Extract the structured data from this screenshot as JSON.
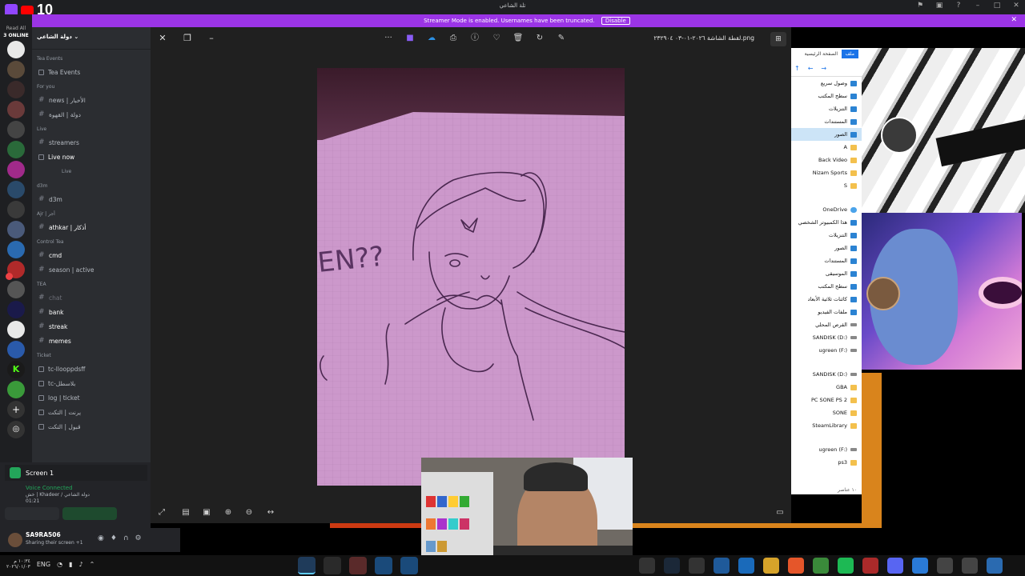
{
  "top": {
    "title": "تلة الشاعي",
    "number": "10",
    "streamer_message": "Streamer Mode is enabled. Usernames have been truncated.",
    "disable_label": "Disable"
  },
  "rail": {
    "read_all": "Read All",
    "online": "3 ONLINE"
  },
  "server": {
    "name": "دولة الشاعي"
  },
  "channels": [
    {
      "type": "cat",
      "label": "Tea Events"
    },
    {
      "type": "lock",
      "label": "Tea Events"
    },
    {
      "type": "cat",
      "label": "For you"
    },
    {
      "type": "hash",
      "label": "news | الأخبار"
    },
    {
      "type": "hash",
      "label": "دولة | القهوة"
    },
    {
      "type": "cat",
      "label": "Live"
    },
    {
      "type": "hash",
      "label": "streamers"
    },
    {
      "type": "lock-live",
      "label": "Live now"
    },
    {
      "type": "sub",
      "label": "Live"
    },
    {
      "type": "cat",
      "label": "d3m"
    },
    {
      "type": "hash",
      "label": "d3m"
    },
    {
      "type": "cat",
      "label": "Ajr | أجر"
    },
    {
      "type": "hash-bright",
      "label": "athkar | أذكار"
    },
    {
      "type": "cat",
      "label": "Control Tea"
    },
    {
      "type": "hash-bright",
      "label": "cmd"
    },
    {
      "type": "hash",
      "label": "season | active"
    },
    {
      "type": "cat",
      "label": "TEA"
    },
    {
      "type": "hash-dim",
      "label": "chat"
    },
    {
      "type": "hash-bright",
      "label": "bank"
    },
    {
      "type": "hash-bright",
      "label": "streak"
    },
    {
      "type": "hash-bright",
      "label": "memes"
    },
    {
      "type": "cat",
      "label": "Ticket"
    },
    {
      "type": "lock",
      "label": "tc-llooppdsff"
    },
    {
      "type": "lock",
      "label": "tc-بلاسطل"
    },
    {
      "type": "lock",
      "label": "log | ticket"
    },
    {
      "type": "lock",
      "label": "يرنت | التكت"
    },
    {
      "type": "lock",
      "label": "قبول | التكت"
    }
  ],
  "voice": {
    "screen_label": "Screen 1",
    "connected": "Voice Connected",
    "channel": "خش | Khadeer / دولة الشاعي",
    "time": "01:21"
  },
  "user": {
    "name": "SA9RA506",
    "status": "Sharing their screen +1"
  },
  "viewer": {
    "filename": "لقطة الشاشة ٢٠٢٦-٠١-٠٣ ٢٣٢٩٠٤.png"
  },
  "explorer": {
    "tab_file": "ملف",
    "tab_home": "الصفحة الرئيسية",
    "items": [
      {
        "label": "وصول سريع",
        "icon": "star"
      },
      {
        "label": "سطح المكتب",
        "icon": "blue"
      },
      {
        "label": "التنزيلات",
        "icon": "blue"
      },
      {
        "label": "المستندات",
        "icon": "doc"
      },
      {
        "label": "الصور",
        "icon": "blue",
        "selected": true
      },
      {
        "label": "A",
        "icon": "folder"
      },
      {
        "label": "Back Video",
        "icon": "folder"
      },
      {
        "label": "Nizam Sports",
        "icon": "folder"
      },
      {
        "label": "S",
        "icon": "folder"
      },
      {
        "label": "",
        "icon": "gap"
      },
      {
        "label": "OneDrive",
        "icon": "cloud"
      },
      {
        "label": "هذا الكمبيوتر الشخصي",
        "icon": "blue"
      },
      {
        "label": "التنزيلات",
        "icon": "blue"
      },
      {
        "label": "الصور",
        "icon": "blue"
      },
      {
        "label": "المستندات",
        "icon": "doc"
      },
      {
        "label": "الموسيقى",
        "icon": "blue"
      },
      {
        "label": "سطح المكتب",
        "icon": "blue"
      },
      {
        "label": "كائنات ثلاثية الأبعاد",
        "icon": "blue"
      },
      {
        "label": "ملفات الفيديو",
        "icon": "blue"
      },
      {
        "label": "القرص المحلي",
        "icon": "drive"
      },
      {
        "label": "SANDISK (D:)",
        "icon": "drive"
      },
      {
        "label": "ugreen (F:)",
        "icon": "drive"
      },
      {
        "label": "",
        "icon": "gap"
      },
      {
        "label": "SANDISK (D:)",
        "icon": "drive"
      },
      {
        "label": "GBA",
        "icon": "folder"
      },
      {
        "label": "PC SONE PS 2",
        "icon": "folder"
      },
      {
        "label": "SONE",
        "icon": "folder"
      },
      {
        "label": "SteamLibrary",
        "icon": "folder"
      },
      {
        "label": "",
        "icon": "gap"
      },
      {
        "label": "ugreen (F:)",
        "icon": "drive"
      },
      {
        "label": "ps3",
        "icon": "folder"
      }
    ],
    "footer": "١٠ عناصر"
  },
  "taskbar": {
    "lang": "ENG",
    "time": "١٠:٣٤ م",
    "date": "٢٠٢٦/٠١/٠٣"
  }
}
